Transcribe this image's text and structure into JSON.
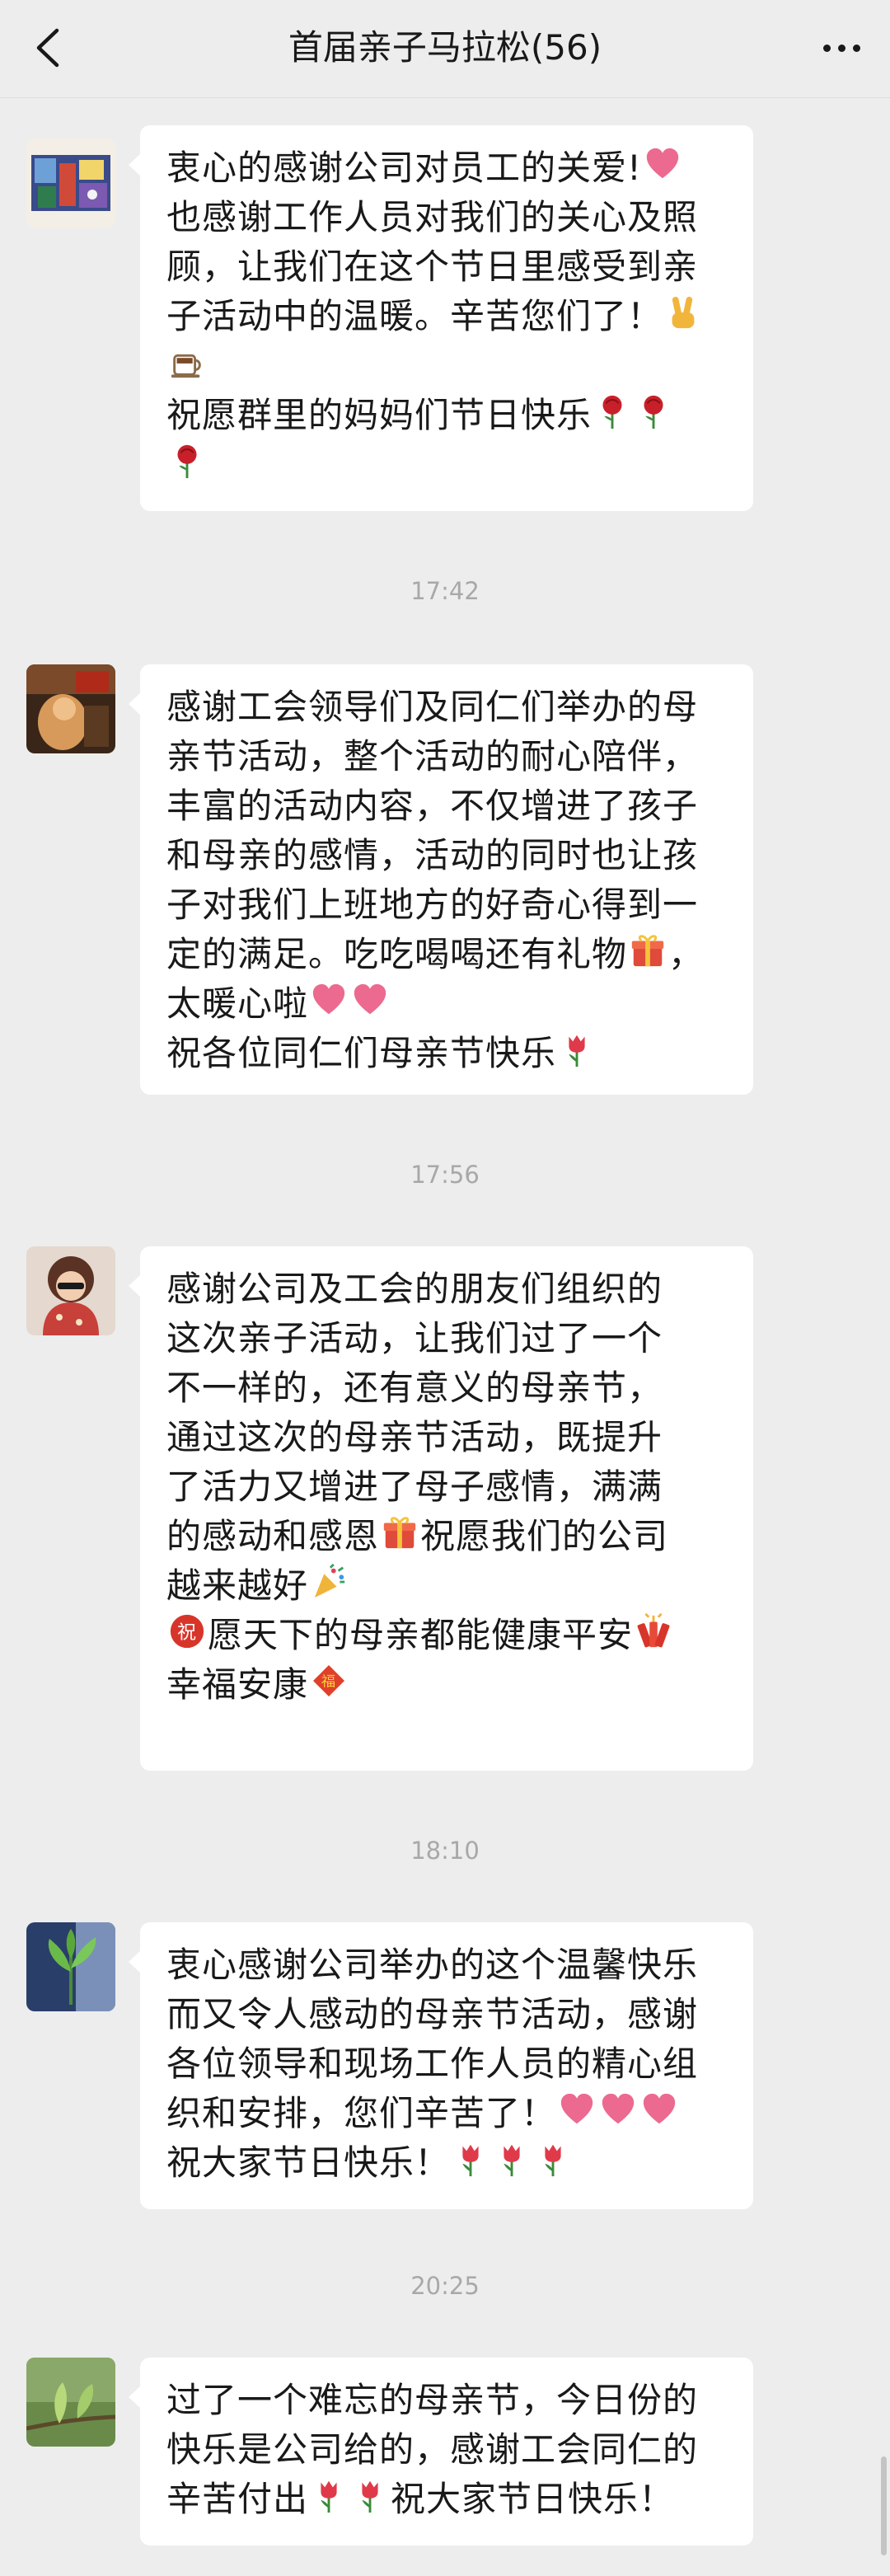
{
  "header": {
    "title": "首届亲子马拉松(56)"
  },
  "timestamps": [
    "17:42",
    "17:56",
    "18:10",
    "20:25"
  ],
  "messages": [
    {
      "avatar_icon": "painting-avatar",
      "lines": [
        [
          "衷心的感谢公司对员工的关爱!",
          "heart-emoji"
        ],
        [
          "也感谢工作人员对我们的关心及照"
        ],
        [
          "顾，让我们在这个节日里感受到亲"
        ],
        [
          "子活动中的温暖。辛苦您们了！",
          "victory-hand-emoji"
        ],
        [
          "coffee-emoji"
        ],
        [
          "祝愿群里的妈妈们节日快乐",
          "rose-emoji",
          "rose-emoji"
        ],
        [
          "rose-emoji"
        ]
      ]
    },
    {
      "avatar_icon": "child-photo-avatar",
      "lines": [
        [
          "感谢工会领导们及同仁们举办的母"
        ],
        [
          "亲节活动，整个活动的耐心陪伴，"
        ],
        [
          "丰富的活动内容，不仅增进了孩子"
        ],
        [
          "和母亲的感情，活动的同时也让孩"
        ],
        [
          "子对我们上班地方的好奇心得到一"
        ],
        [
          "定的满足。吃吃喝喝还有礼物",
          "gift-emoji",
          "，"
        ],
        [
          "太暖心啦",
          "heart-emoji",
          "heart-emoji"
        ],
        [
          "祝各位同仁们母亲节快乐",
          "tulip-emoji"
        ]
      ]
    },
    {
      "avatar_icon": "girl-photo-avatar",
      "lines": [
        [
          "感谢公司及工会的朋友们组织的"
        ],
        [
          "这次亲子活动，让我们过了一个"
        ],
        [
          "不一样的，还有意义的母亲节，"
        ],
        [
          "通过这次的母亲节活动，既提升"
        ],
        [
          "了活力又增进了母子感情，满满"
        ],
        [
          "的感动和感恩",
          "gift-emoji",
          "祝愿我们的公司"
        ],
        [
          "越来越好",
          "party-popper-emoji"
        ],
        [
          "congratulation-emoji",
          "愿天下的母亲都能健康平安",
          "firecracker-emoji"
        ],
        [
          "幸福安康",
          "fu-emoji"
        ]
      ]
    },
    {
      "avatar_icon": "plant-photo-avatar",
      "lines": [
        [
          "衷心感谢公司举办的这个温馨快乐"
        ],
        [
          "而又令人感动的母亲节活动，感谢"
        ],
        [
          "各位领导和现场工作人员的精心组"
        ],
        [
          "织和安排，您们辛苦了！",
          "heart-emoji",
          "heart-emoji",
          "heart-emoji"
        ],
        [
          "祝大家节日快乐！",
          "tulip-emoji",
          "tulip-emoji",
          "tulip-emoji"
        ]
      ]
    },
    {
      "avatar_icon": "leaf-photo-avatar",
      "lines": [
        [
          "过了一个难忘的母亲节，今日份的"
        ],
        [
          "快乐是公司给的，感谢工会同仁的"
        ],
        [
          "辛苦付出",
          "tulip-emoji",
          "tulip-emoji",
          "祝大家节日快乐！"
        ]
      ]
    }
  ]
}
